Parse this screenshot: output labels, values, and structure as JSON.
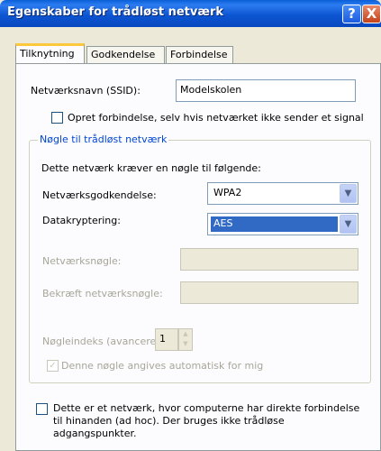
{
  "window": {
    "title": "Egenskaber for trådløst netværk",
    "help_glyph": "?",
    "close_glyph": "X"
  },
  "tabs": [
    {
      "label": "Tilknytning",
      "active": true
    },
    {
      "label": "Godkendelse",
      "active": false
    },
    {
      "label": "Forbindelse",
      "active": false
    }
  ],
  "ssid": {
    "label": "Netværksnavn (SSID):",
    "value": "Modelskolen"
  },
  "broadcast_checkbox": {
    "label": "Opret forbindelse, selv hvis netværket ikke sender et signal",
    "checked": false
  },
  "key_group": {
    "title": "Nøgle til trådløst netværk",
    "intro": "Dette netværk kræver en nøgle til følgende:",
    "auth": {
      "label": "Netværksgodkendelse:",
      "value": "WPA2"
    },
    "encryption": {
      "label": "Datakryptering:",
      "value": "AES"
    },
    "network_key": {
      "label": "Netværksnøgle:",
      "value": ""
    },
    "confirm_key": {
      "label": "Bekræft netværksnøgle:",
      "value": ""
    },
    "key_index": {
      "label": "Nøgleindeks (avanceret):",
      "value": "1"
    },
    "auto_key": {
      "label": "Denne nøgle angives automatisk for mig",
      "checked": true
    }
  },
  "adhoc_checkbox": {
    "line1": "Dette er et netværk, hvor computerne har direkte forbindelse",
    "line2": "til hinanden (ad hoc). Der bruges ikke trådløse",
    "line3": "adgangspunkter.",
    "checked": false
  }
}
